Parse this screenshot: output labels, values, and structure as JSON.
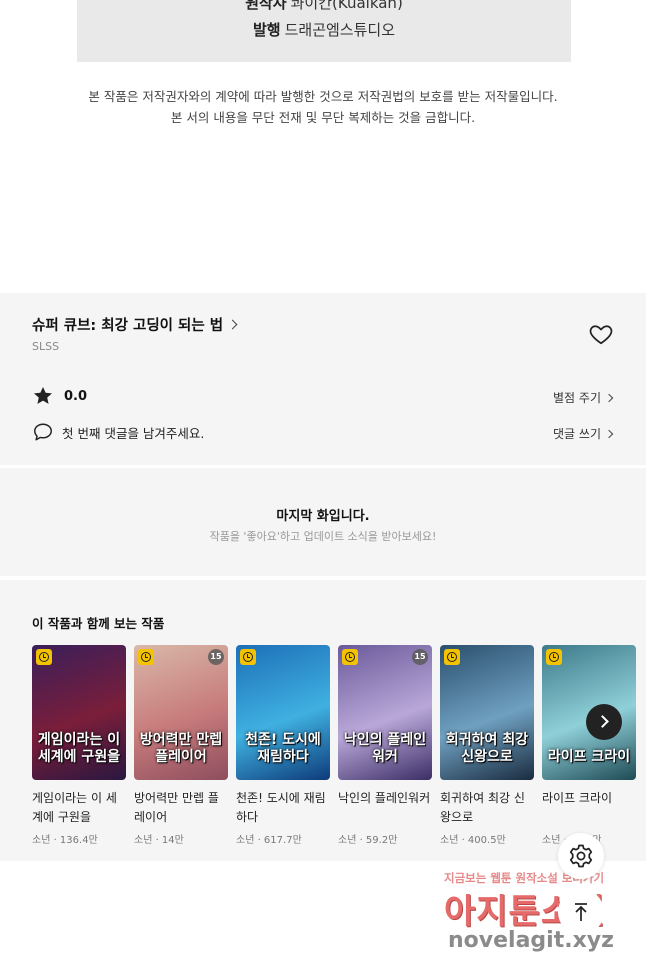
{
  "credits": {
    "original_label": "원작사",
    "original_value": "콰이칸(Kuaikan)",
    "publisher_label": "발행",
    "publisher_value": "드래곤엠스튜디오"
  },
  "copyright": {
    "line1": "본 작품은 저작권자와의 계약에 따라 발행한 것으로 저작권법의 보호를 받는 저작물입니다.",
    "line2": "본 서의 내용을 무단 전재 및 무단 복제하는 것을 금합니다."
  },
  "series": {
    "title": "슈퍼 큐브: 최강 고딩이 되는 법",
    "author": "SLSS",
    "rating": "0.0",
    "rate_link": "별점 주기",
    "comment_prompt": "첫 번째 댓글을 남겨주세요.",
    "comment_link": "댓글 쓰기"
  },
  "last_episode": {
    "title": "마지막 화입니다.",
    "subtitle": "작품을 '좋아요'하고 업데이트 소식을 받아보세요!"
  },
  "recommendations": {
    "heading": "이 작품과 함께 보는 작품",
    "items": [
      {
        "title": "게임이라는 이 세계에 구원을",
        "cover_text": "게임이라는 이 세계에 구원을",
        "meta": "소년 · 136.4만",
        "age": "",
        "colors": [
          "#3a1f5a",
          "#7a1e3a",
          "#2a1740"
        ]
      },
      {
        "title": "방어력만 만렙 플레이어",
        "cover_text": "방어력만 만렙 플레이어",
        "meta": "소년 · 14만",
        "age": "15",
        "colors": [
          "#d9b8a8",
          "#c77b7b",
          "#8e4d5e"
        ]
      },
      {
        "title": "천존! 도시에 재림하다",
        "cover_text": "천존! 도시에 재림하다",
        "meta": "소년 · 617.7만",
        "age": "",
        "colors": [
          "#1d6fb8",
          "#3fb0e0",
          "#0e3b7a"
        ]
      },
      {
        "title": "낙인의 플레인워커",
        "cover_text": "낙인의 플레인워커",
        "meta": "소년 · 59.2만",
        "age": "15",
        "colors": [
          "#6a5a9a",
          "#b9a7d8",
          "#3c2f66"
        ]
      },
      {
        "title": "회귀하여 최강 신왕으로",
        "cover_text": "회귀하여 최강 신왕으로",
        "meta": "소년 · 400.5만",
        "age": "",
        "colors": [
          "#2b4f6e",
          "#6fa0c0",
          "#1a2c40"
        ]
      },
      {
        "title": "라이프 크라이",
        "cover_text": "라이프 크라이",
        "meta": "소년 · 75.6만",
        "age": "",
        "colors": [
          "#3e7a8a",
          "#8fd0d8",
          "#1e4a55"
        ]
      }
    ]
  },
  "watermark": {
    "line1": "지금보는 웹툰 원작소설 보러가기",
    "line2": "아지툰소설",
    "line3": "novelagit.xyz"
  },
  "icons": {
    "heart": "heart-icon",
    "star": "star-icon",
    "comment": "comment-bubble-icon",
    "next": "chevron-right-icon",
    "settings": "gear-icon",
    "top": "arrow-up-icon",
    "clock": "clock-badge-icon"
  }
}
